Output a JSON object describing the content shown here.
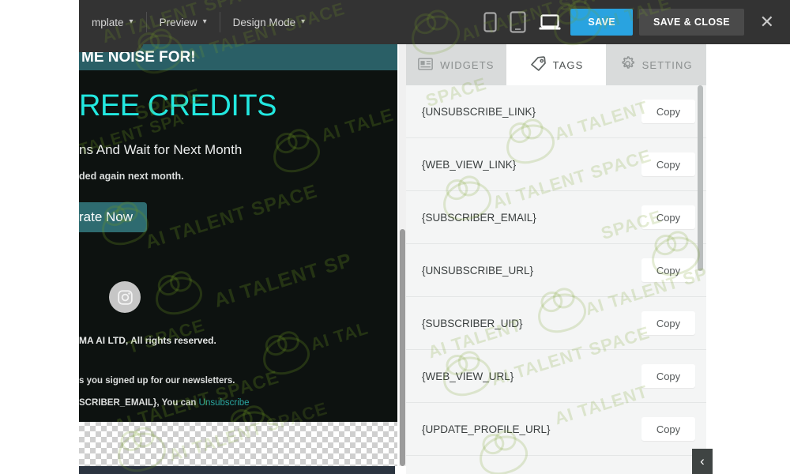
{
  "toolbar": {
    "menus": [
      {
        "label": "mplate",
        "icon": "chevron-down-icon"
      },
      {
        "label": "Preview",
        "icon": "chevron-down-icon"
      },
      {
        "label": "Design Mode",
        "icon": "chevron-down-icon"
      }
    ],
    "devices": [
      {
        "name": "mobile-device-icon",
        "label": "Mobile",
        "active": false
      },
      {
        "name": "tablet-device-icon",
        "label": "Tablet",
        "active": false
      },
      {
        "name": "desktop-device-icon",
        "label": "Desktop",
        "active": true
      }
    ],
    "save_label": "SAVE",
    "save_close_label": "SAVE & CLOSE",
    "close_label": "✕",
    "colors": {
      "bar": "#333333",
      "save": "#29a3e0",
      "save_close": "#4a4a4a"
    }
  },
  "email": {
    "banner_text": "ME NOISE FOR!",
    "heading": "REE CREDITS",
    "subheading": "ns And Wait for Next Month",
    "paragraph": "ded again next month.",
    "cta_label": "rate Now",
    "social_icon": "instagram-icon",
    "footer_copyright": "MA AI LTD, All rights reserved.",
    "footer_reason": "s you signed up for our newsletters.",
    "footer_email_line": "SCRIBER_EMAIL}, You can ",
    "footer_unsubscribe": "Unsubscribe",
    "colors": {
      "banner": "#2a5f66",
      "body": "#0d1210",
      "heading": "#22e8e0",
      "cta": "#2e6b70",
      "link": "#2aa6a0"
    }
  },
  "panel": {
    "tabs": [
      {
        "label": "WIDGETS",
        "icon": "widgets-grid-icon",
        "active": false
      },
      {
        "label": "TAGS",
        "icon": "tag-icon",
        "active": true
      },
      {
        "label": "SETTING",
        "icon": "gear-icon",
        "active": false
      }
    ],
    "copy_label": "Copy",
    "tags": [
      "{UNSUBSCRIBE_LINK}",
      "{WEB_VIEW_LINK}",
      "{SUBSCRIBER_EMAIL}",
      "{UNSUBSCRIBE_URL}",
      "{SUBSCRIBER_UID}",
      "{WEB_VIEW_URL}",
      "{UPDATE_PROFILE_URL}"
    ],
    "collapse_label": "‹"
  },
  "watermark": {
    "text": "AI TALENT SPACE",
    "short": "AI TALE",
    "space": "SPACE",
    "color": "#78a028"
  }
}
